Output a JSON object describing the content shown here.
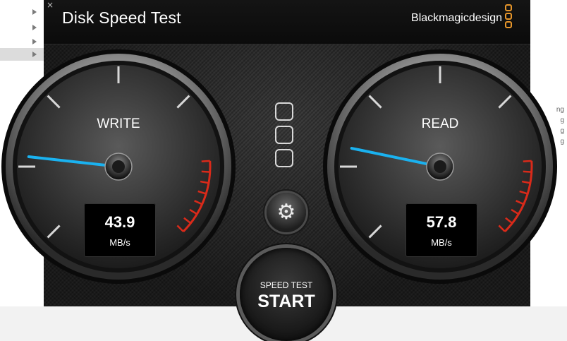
{
  "background": {
    "right_fragments": [
      "ng",
      "g",
      "g",
      "g"
    ]
  },
  "window": {
    "close_symbol": "×",
    "title": "Disk Speed Test",
    "brand": "Blackmagicdesign",
    "brand_logo_icon": "three-rounded-squares-icon"
  },
  "write_gauge": {
    "label": "WRITE",
    "value": "43.9",
    "unit": "MB/s",
    "needle_fraction": 0.19
  },
  "read_gauge": {
    "label": "READ",
    "value": "57.8",
    "unit": "MB/s",
    "needle_fraction": 0.21
  },
  "center_icon": "three-stacked-squares-icon",
  "settings_icon": "gear-icon",
  "start_button": {
    "small_label": "SPEED TEST",
    "big_label": "START"
  },
  "colors": {
    "brand_orange": "#e8962a",
    "needle_blue": "#1ab2f0",
    "redline": "#d92a1a"
  }
}
